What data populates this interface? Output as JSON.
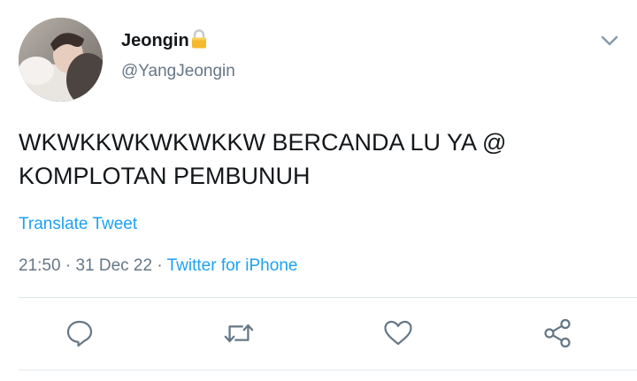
{
  "author": {
    "display_name": "Jeongin",
    "handle": "@YangJeongin",
    "protected_icon": "lock-icon"
  },
  "tweet": {
    "text_line1": "WKWKKWKWKWKKW BERCANDA LU YA @",
    "text_line2": "KOMPLOTAN PEMBUNUH",
    "translate_label": "Translate Tweet",
    "time": "21:50",
    "date": "31 Dec 22",
    "separator": "·",
    "source": "Twitter for iPhone"
  },
  "actions": {
    "reply_icon": "reply-icon",
    "retweet_icon": "retweet-icon",
    "like_icon": "heart-icon",
    "share_icon": "share-icon"
  },
  "colors": {
    "text": "#14171a",
    "secondary": "#657786",
    "accent": "#1da1f2",
    "divider": "#e1e8ed"
  }
}
